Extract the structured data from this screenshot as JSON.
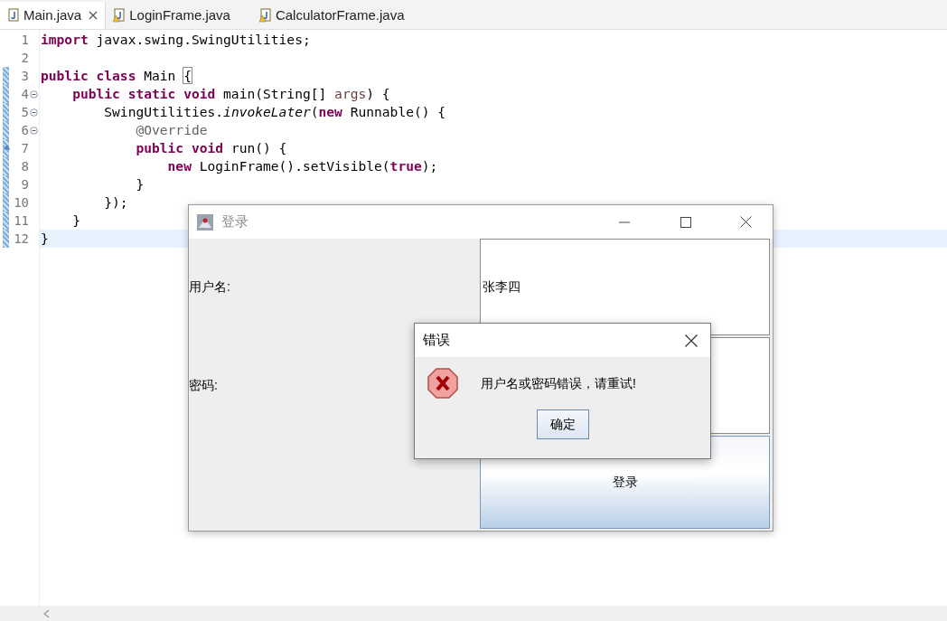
{
  "tabs": [
    {
      "label": "Main.java",
      "selected": true,
      "warning": false
    },
    {
      "label": "LoginFrame.java",
      "selected": false,
      "warning": true
    },
    {
      "label": "CalculatorFrame.java",
      "selected": false,
      "warning": true
    }
  ],
  "editor": {
    "lines": [
      {
        "number": "1",
        "changed": false,
        "current": false,
        "fold": false,
        "override": false,
        "tokens": [
          {
            "kind": "keyword",
            "text": "import"
          },
          {
            "kind": "plain",
            "text": " javax.swing.SwingUtilities;"
          }
        ]
      },
      {
        "number": "2",
        "changed": false,
        "current": false,
        "fold": false,
        "override": false
      },
      {
        "number": "3",
        "changed": true,
        "current": false,
        "fold": false,
        "override": false,
        "tokens": [
          {
            "kind": "keyword",
            "text": "public class"
          },
          {
            "kind": "plain",
            "text": " Main "
          },
          {
            "kind": "bracket",
            "text": "{"
          }
        ]
      },
      {
        "number": "4",
        "changed": true,
        "current": false,
        "fold": true,
        "override": false,
        "tokens": [
          {
            "kind": "keyword",
            "text": "    public static void"
          },
          {
            "kind": "plain",
            "text": " main(String[] "
          },
          {
            "kind": "param",
            "text": "args"
          },
          {
            "kind": "plain",
            "text": ") {"
          }
        ]
      },
      {
        "number": "5",
        "changed": true,
        "current": false,
        "fold": true,
        "override": false,
        "tokens": [
          {
            "kind": "plain",
            "text": "        SwingUtilities."
          },
          {
            "kind": "italic",
            "text": "invokeLater"
          },
          {
            "kind": "plain",
            "text": "("
          },
          {
            "kind": "keyword",
            "text": "new"
          },
          {
            "kind": "plain",
            "text": " Runnable() {"
          }
        ]
      },
      {
        "number": "6",
        "changed": true,
        "current": false,
        "fold": true,
        "override": false,
        "tokens": [
          {
            "kind": "annotation",
            "text": "            @Override"
          }
        ]
      },
      {
        "number": "7",
        "changed": true,
        "current": false,
        "fold": false,
        "override": true,
        "tokens": [
          {
            "kind": "keyword",
            "text": "            public void"
          },
          {
            "kind": "plain",
            "text": " run() {"
          }
        ]
      },
      {
        "number": "8",
        "changed": true,
        "current": false,
        "fold": false,
        "override": false,
        "tokens": [
          {
            "kind": "keyword",
            "text": "                new"
          },
          {
            "kind": "plain",
            "text": " LoginFrame().setVisible("
          },
          {
            "kind": "keyword",
            "text": "true"
          },
          {
            "kind": "plain",
            "text": ");"
          }
        ]
      },
      {
        "number": "9",
        "changed": true,
        "current": false,
        "fold": false,
        "override": false,
        "tokens": [
          {
            "kind": "plain",
            "text": "            }"
          }
        ]
      },
      {
        "number": "10",
        "changed": true,
        "current": false,
        "fold": false,
        "override": false,
        "tokens": [
          {
            "kind": "plain",
            "text": "        });"
          }
        ]
      },
      {
        "number": "11",
        "changed": true,
        "current": false,
        "fold": false,
        "override": false,
        "tokens": [
          {
            "kind": "plain",
            "text": "    }"
          }
        ]
      },
      {
        "number": "12",
        "changed": true,
        "current": true,
        "fold": false,
        "override": false,
        "tokens": [
          {
            "kind": "plain",
            "text": "}"
          }
        ]
      }
    ]
  },
  "login_window": {
    "title": "登录",
    "username_label": "用户名:",
    "username_value": "张李四",
    "password_label": "密码:",
    "login_button": "登录"
  },
  "error_dialog": {
    "title": "错误",
    "message": "用户名或密码错误，请重试!",
    "ok_button": "确定"
  }
}
